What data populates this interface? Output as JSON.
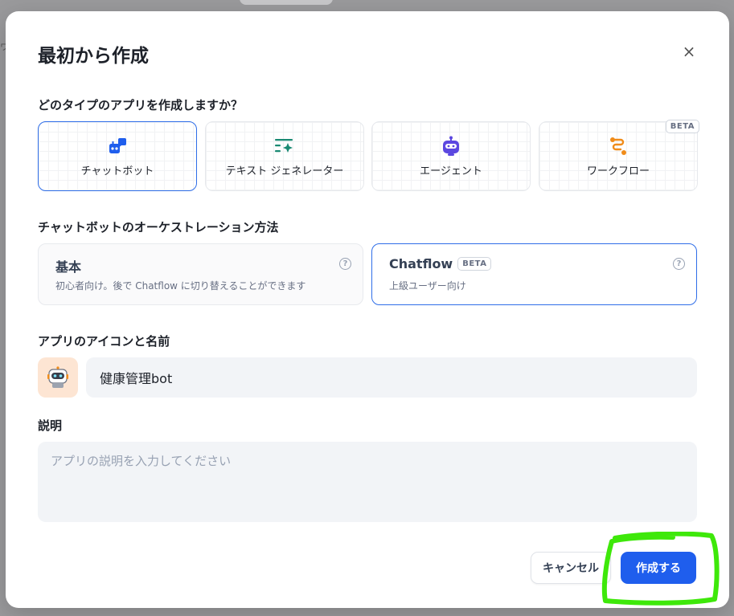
{
  "modal": {
    "title": "最初から作成",
    "close_glyph": "×"
  },
  "app_type": {
    "label": "どのタイプのアプリを作成しますか？",
    "options": [
      {
        "label": "チャットボット",
        "icon": "chatbot-icon",
        "selected": true
      },
      {
        "label": "テキスト ジェネレーター",
        "icon": "text-generator-icon",
        "selected": false
      },
      {
        "label": "エージェント",
        "icon": "agent-icon",
        "selected": false
      },
      {
        "label": "ワークフロー",
        "icon": "workflow-icon",
        "selected": false,
        "badge": "BETA"
      }
    ]
  },
  "orchestration": {
    "label": "チャットボットのオーケストレーション方法",
    "options": [
      {
        "title": "基本",
        "desc": "初心者向け。後で Chatflow に切り替えることができます",
        "selected": false
      },
      {
        "title": "Chatflow",
        "badge": "BETA",
        "desc": "上級ユーザー向け",
        "selected": true
      }
    ],
    "help_glyph": "?"
  },
  "app_identity": {
    "label": "アプリのアイコンと名前",
    "name_value": "健康管理bot",
    "avatar_icon": "robot-icon"
  },
  "description": {
    "label": "説明",
    "placeholder": "アプリの説明を入力してください"
  },
  "footer": {
    "cancel_label": "キャンセル",
    "create_label": "作成する"
  },
  "colors": {
    "accent": "#1f5eed",
    "highlight": "#3ee80a"
  }
}
